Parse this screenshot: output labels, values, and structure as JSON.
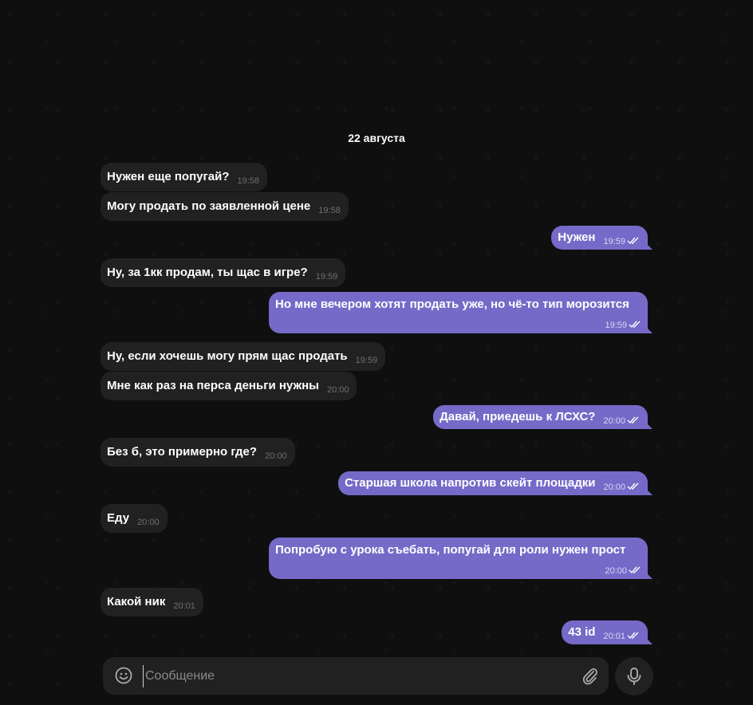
{
  "date_separator": "22 августа",
  "messages": [
    {
      "text": "Нужен еще попугай?",
      "time": "19:58"
    },
    {
      "text": "Могу продать по заявленной цене",
      "time": "19:58"
    },
    {
      "text": "Нужен",
      "time": "19:59"
    },
    {
      "text": "Ну, за 1кк продам, ты щас в игре?",
      "time": "19:59"
    },
    {
      "text": "Но мне вечером хотят продать уже, но чё-то тип морозится",
      "time": "19:59"
    },
    {
      "text": "Ну, если хочешь могу прям щас продать",
      "time": "19:59"
    },
    {
      "text": "Мне как раз на перса деньги нужны",
      "time": "20:00"
    },
    {
      "text": "Давай, приедешь к ЛСХС?",
      "time": "20:00"
    },
    {
      "text": "Без б, это примерно где?",
      "time": "20:00"
    },
    {
      "text": "Старшая школа напротив скейт площадки",
      "time": "20:00"
    },
    {
      "text": "Еду",
      "time": "20:00"
    },
    {
      "text": "Попробую с урока съебать, попугай для роли нужен прост",
      "time": "20:00"
    },
    {
      "text": "Какой ник",
      "time": "20:01"
    },
    {
      "text": "43 id",
      "time": "20:01"
    }
  ],
  "composer": {
    "placeholder": "Сообщение"
  },
  "icons": {
    "emoji": "emoji-icon",
    "attach": "paperclip-icon",
    "mic": "microphone-icon",
    "read": "double-check-icon"
  },
  "colors": {
    "outgoing_bubble": "#766ac8",
    "incoming_bubble": "#212121",
    "background": "#0f0f0f"
  }
}
